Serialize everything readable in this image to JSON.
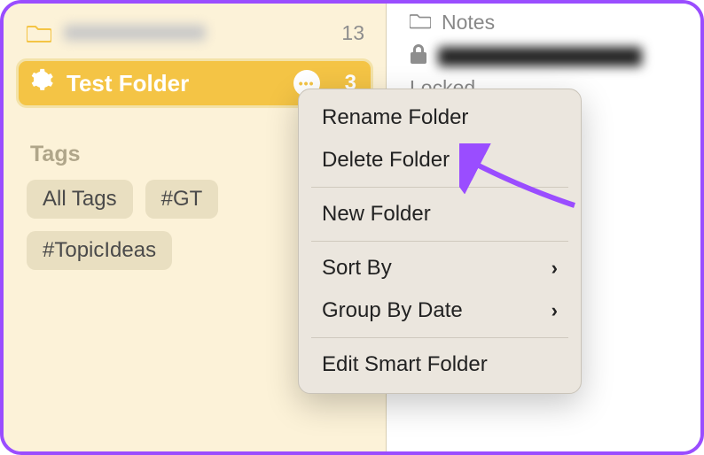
{
  "sidebar": {
    "folder1": {
      "count": "13"
    },
    "selected_folder": {
      "label": "Test Folder",
      "count": "3"
    },
    "tags_header": "Tags",
    "tags": {
      "all": "All Tags",
      "gt": "#GT",
      "topic": "#TopicIdeas"
    }
  },
  "context_menu": {
    "rename": "Rename Folder",
    "delete": "Delete Folder",
    "new_folder": "New Folder",
    "sort_by": "Sort By",
    "group_by_date": "Group By Date",
    "edit_smart": "Edit Smart Folder"
  },
  "notes": {
    "folder_label": "Notes",
    "locked": "Locked"
  },
  "colors": {
    "accent": "#f4c445",
    "arrow": "#9a4dff"
  }
}
